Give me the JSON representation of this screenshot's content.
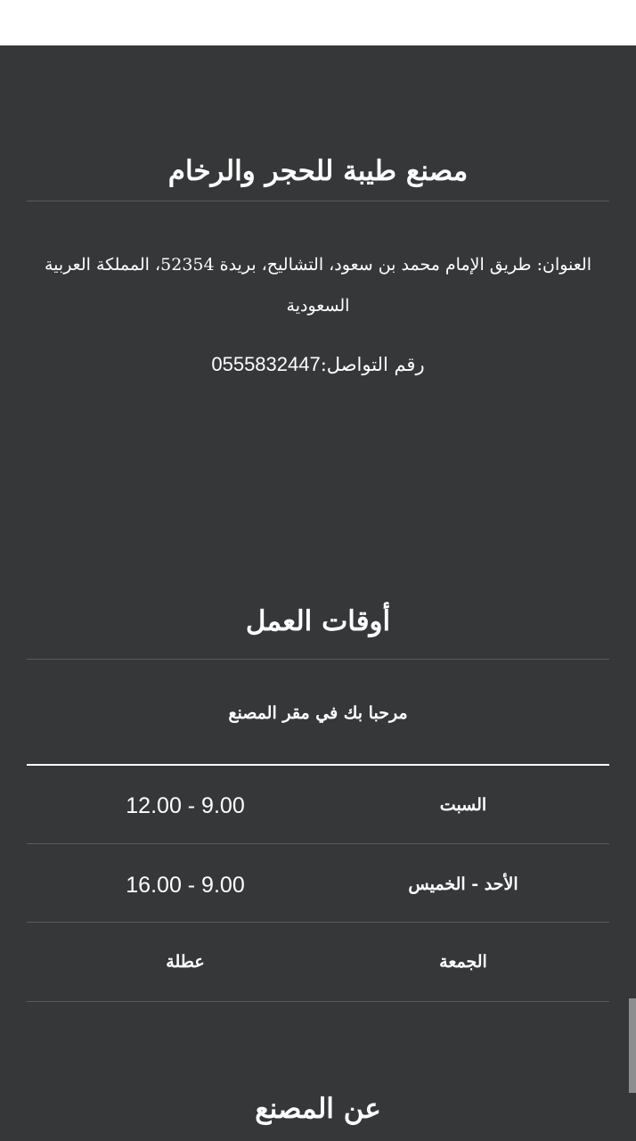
{
  "factory": {
    "title": "مصنع طيبة للحجر والرخام",
    "address": "العنوان: طريق الإمام محمد بن سعود، التشاليح، بريدة 52354، المملكة العربية السعودية",
    "phone_label": "رقم التواصل:",
    "phone_number": "0555832447"
  },
  "hours": {
    "title": "أوقات العمل",
    "welcome": "مرحبا بك في مقر المصنع",
    "rows": [
      {
        "day": "السبت",
        "time": "12.00 - 9.00"
      },
      {
        "day": "الأحد - الخميس",
        "time": "16.00 - 9.00"
      },
      {
        "day": "الجمعة",
        "time": "عطلة"
      }
    ]
  },
  "about": {
    "title": "عن المصنع"
  }
}
